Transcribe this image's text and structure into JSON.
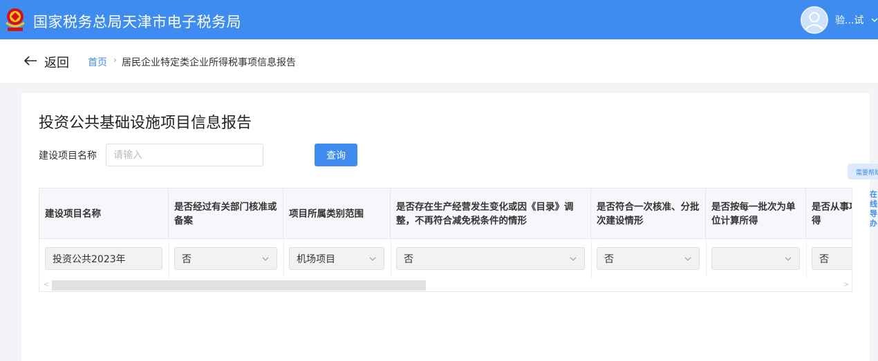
{
  "header": {
    "title": "国家税务总局天津市电子税务局",
    "user_name": "验...试",
    "colors": {
      "primary": "#3f8cf1",
      "emblem": "#d0121b"
    }
  },
  "nav": {
    "back_label": "返回",
    "breadcrumb_home": "首页",
    "breadcrumb_sep": "›",
    "breadcrumb_current": "居民企业特定类企业所得税事项信息报告"
  },
  "page": {
    "title": "投资公共基础设施项目信息报告",
    "search_label": "建设项目名称",
    "search_placeholder": "请输入",
    "search_value": "",
    "query_button": "查询"
  },
  "help": {
    "label": "需要帮助",
    "side_text": "在线导办"
  },
  "table": {
    "columns": [
      "建设项目名称",
      "是否经过有关部门核准或备案",
      "项目所属类别范围",
      "是否存在生产经营发生变化或因《目录》调整，不再符合减免税条件的情形",
      "是否符合一次核准、分批次建设情形",
      "是否按每一批次为单位计算所得",
      "是否从事项目取得所得"
    ],
    "rows": [
      {
        "project_name": "投资公共2023年",
        "approved": "否",
        "category": "机场项目",
        "condition_changed": "否",
        "batch_build": "否",
        "batch_income": "",
        "income_from_project": "否"
      }
    ]
  }
}
